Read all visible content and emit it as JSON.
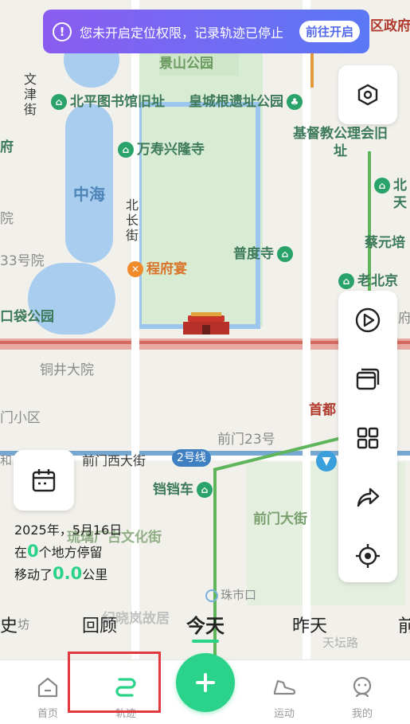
{
  "notice": {
    "text": "您未开启定位权限，记录轨迹已停止",
    "action_label": "前往开启",
    "icon": "exclamation-circle-icon"
  },
  "map": {
    "labels": {
      "jingshan": "景山公园",
      "wenjin": "文津街",
      "beiping_library": "北平图书馆旧址",
      "huangcheng": "皇城根遗址公园",
      "wanshou": "万寿兴隆寺",
      "zhonghai": "中海",
      "beichang": "北长街",
      "christian": "基督教公理会旧址",
      "cai_yuanpei": "蔡元培",
      "pudu": "普度寺",
      "lao_beijing": "老北京",
      "chengfu": "程府宴",
      "sanhao": "33号院",
      "koudai": "口袋公园",
      "tongjing": "铜井大院",
      "menxiao": "门小区",
      "qianmen23": "前门23号",
      "shoudu": "首都",
      "qianmen_west": "前门西大街",
      "line2": "2号线",
      "dangdang": "铛铛车",
      "qianmen_street": "前门大街",
      "liulichang": "琉璃厂古文化街",
      "zhushikou": "珠市口",
      "jixiao": "纪晓岚故居",
      "tiantan": "天坛路",
      "district": "区政府",
      "fu": "府",
      "yuan": "院",
      "bei": "北",
      "tian": "天",
      "fu2": "府",
      "he": "和",
      "jie": "街",
      "fang": "坊"
    }
  },
  "toolbar_top": {
    "icon": "hexagon-settings-icon"
  },
  "toolbar_right": {
    "items": [
      "play-circle-icon",
      "cards-icon",
      "grid-icon",
      "share-icon",
      "locate-icon"
    ]
  },
  "date_card": {
    "icon": "calendar-icon"
  },
  "stats": {
    "date": "2025年，5月16日",
    "stay_prefix": "在",
    "stay_count": "0",
    "stay_suffix": "个地方停留",
    "move_prefix": "移动了",
    "move_distance": "0.0",
    "move_unit": "公里"
  },
  "day_tabs": {
    "items": [
      "史",
      "回顾",
      "今天",
      "昨天",
      "前"
    ],
    "active": "今天"
  },
  "bottom_nav": {
    "home": "首页",
    "track": "轨迹",
    "sport": "运动",
    "mine": "我的",
    "fab_icon": "plus-icon"
  },
  "colors": {
    "accent": "#2bd28a",
    "notice_start": "#8a5cf0",
    "notice_end": "#5b78f5",
    "highlight": "#e0393e"
  }
}
